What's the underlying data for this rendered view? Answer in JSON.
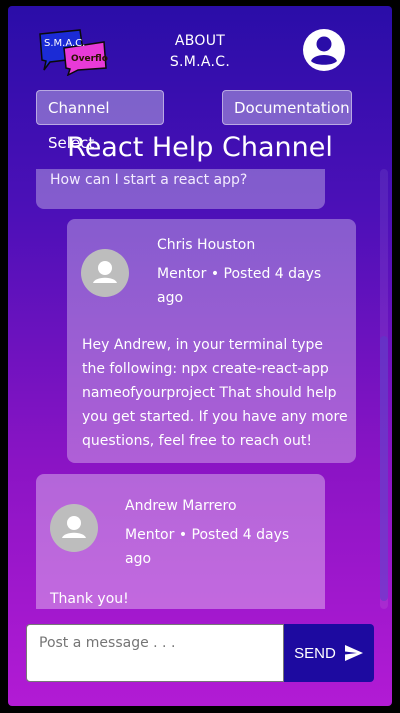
{
  "header": {
    "logo_text": "S.M.A.C. Overflow",
    "about_line1": "ABOUT",
    "about_line2": "S.M.A.C.",
    "profile_icon": "account-circle-icon"
  },
  "nav": {
    "channel_select": "Channel Select",
    "documentation": "Documentation"
  },
  "channel": {
    "title": "React Help Channel"
  },
  "messages": [
    {
      "text": "How can I start a react app?"
    },
    {
      "author": "Chris Houston",
      "meta": "Mentor • Posted 4 days ago",
      "text": "Hey Andrew, in your terminal type the following: npx create-react-app nameofyourproject That should help you get started. If you have any more questions, feel free to reach out!"
    },
    {
      "author": "Andrew Marrero",
      "meta": "Mentor • Posted 4 days ago",
      "text": "Thank you!"
    }
  ],
  "composer": {
    "placeholder": "Post a message . . .",
    "send_label": "SEND",
    "send_icon": "send-icon"
  },
  "colors": {
    "gradient_top": "#2a0da8",
    "gradient_bottom": "#b21bd4",
    "send_button": "#1d0aa0"
  }
}
